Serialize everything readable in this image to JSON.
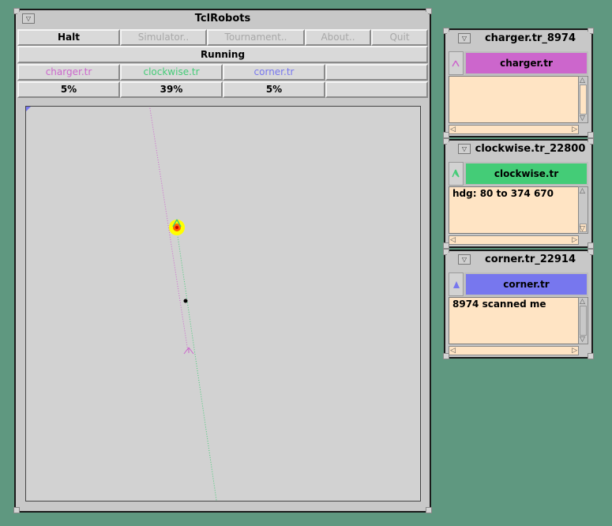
{
  "main_window": {
    "title": "TclRobots",
    "buttons": [
      {
        "label": "Halt",
        "enabled": true
      },
      {
        "label": "Simulator..",
        "enabled": false
      },
      {
        "label": "Tournament..",
        "enabled": false
      },
      {
        "label": "About..",
        "enabled": false
      },
      {
        "label": "Quit",
        "enabled": false
      }
    ],
    "status": "Running",
    "robots": [
      {
        "name": "charger.tr",
        "color": "#cc66cc",
        "damage": "5%"
      },
      {
        "name": "clockwise.tr",
        "color": "#44cc77",
        "damage": "39%"
      },
      {
        "name": "corner.tr",
        "color": "#7777ee",
        "damage": "5%"
      },
      {
        "name": "",
        "color": "#000000",
        "damage": ""
      }
    ]
  },
  "robot_windows": [
    {
      "title": "charger.tr_8974",
      "name": "charger.tr",
      "bar_color": "#cc66cc",
      "icon": "charger-robot-icon",
      "message": ""
    },
    {
      "title": "clockwise.tr_22800",
      "name": "clockwise.tr",
      "bar_color": "#44cc77",
      "icon": "clockwise-robot-icon",
      "message": "hdg: 80 to 374 670"
    },
    {
      "title": "corner.tr_22914",
      "name": "corner.tr",
      "bar_color": "#7777ee",
      "icon": "corner-robot-icon",
      "message": "8974 scanned me"
    }
  ]
}
